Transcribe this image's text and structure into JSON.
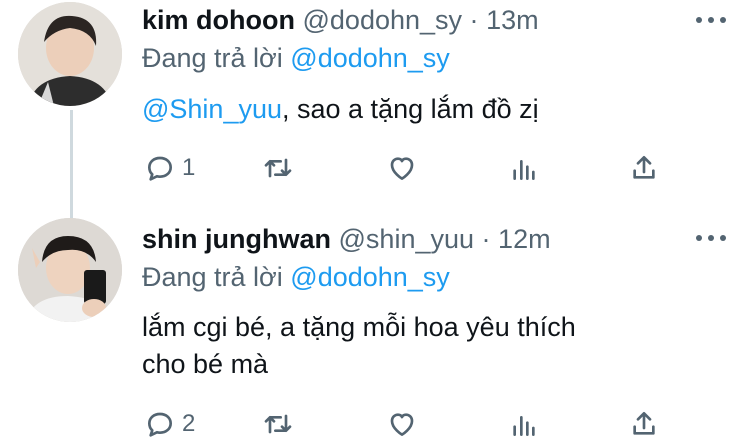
{
  "tweets": [
    {
      "author_name": "kim dohoon",
      "handle": "@dodohn_sy",
      "separator": "·",
      "time": "13m",
      "reply_prefix": "Đang trả lời",
      "reply_to": "@dodohn_sy",
      "text_mention": "@Shin_yuu",
      "text_rest": ", sao a tặng lắm đồ zị",
      "reply_count": "1",
      "icons": [
        "reply-icon",
        "retweet-icon",
        "like-icon",
        "analytics-icon",
        "share-icon"
      ]
    },
    {
      "author_name": "shin junghwan",
      "handle": "@shin_yuu",
      "separator": "·",
      "time": "12m",
      "reply_prefix": "Đang trả lời",
      "reply_to": "@dodohn_sy",
      "text_line1": "lắm cgi bé, a tặng mỗi hoa yêu thích",
      "text_line2": "cho bé mà",
      "reply_count": "2",
      "icons": [
        "reply-icon",
        "retweet-icon",
        "like-icon",
        "analytics-icon",
        "share-icon"
      ]
    }
  ],
  "colors": {
    "link": "#1d9bf0",
    "muted": "#536471",
    "text": "#0f1419"
  }
}
